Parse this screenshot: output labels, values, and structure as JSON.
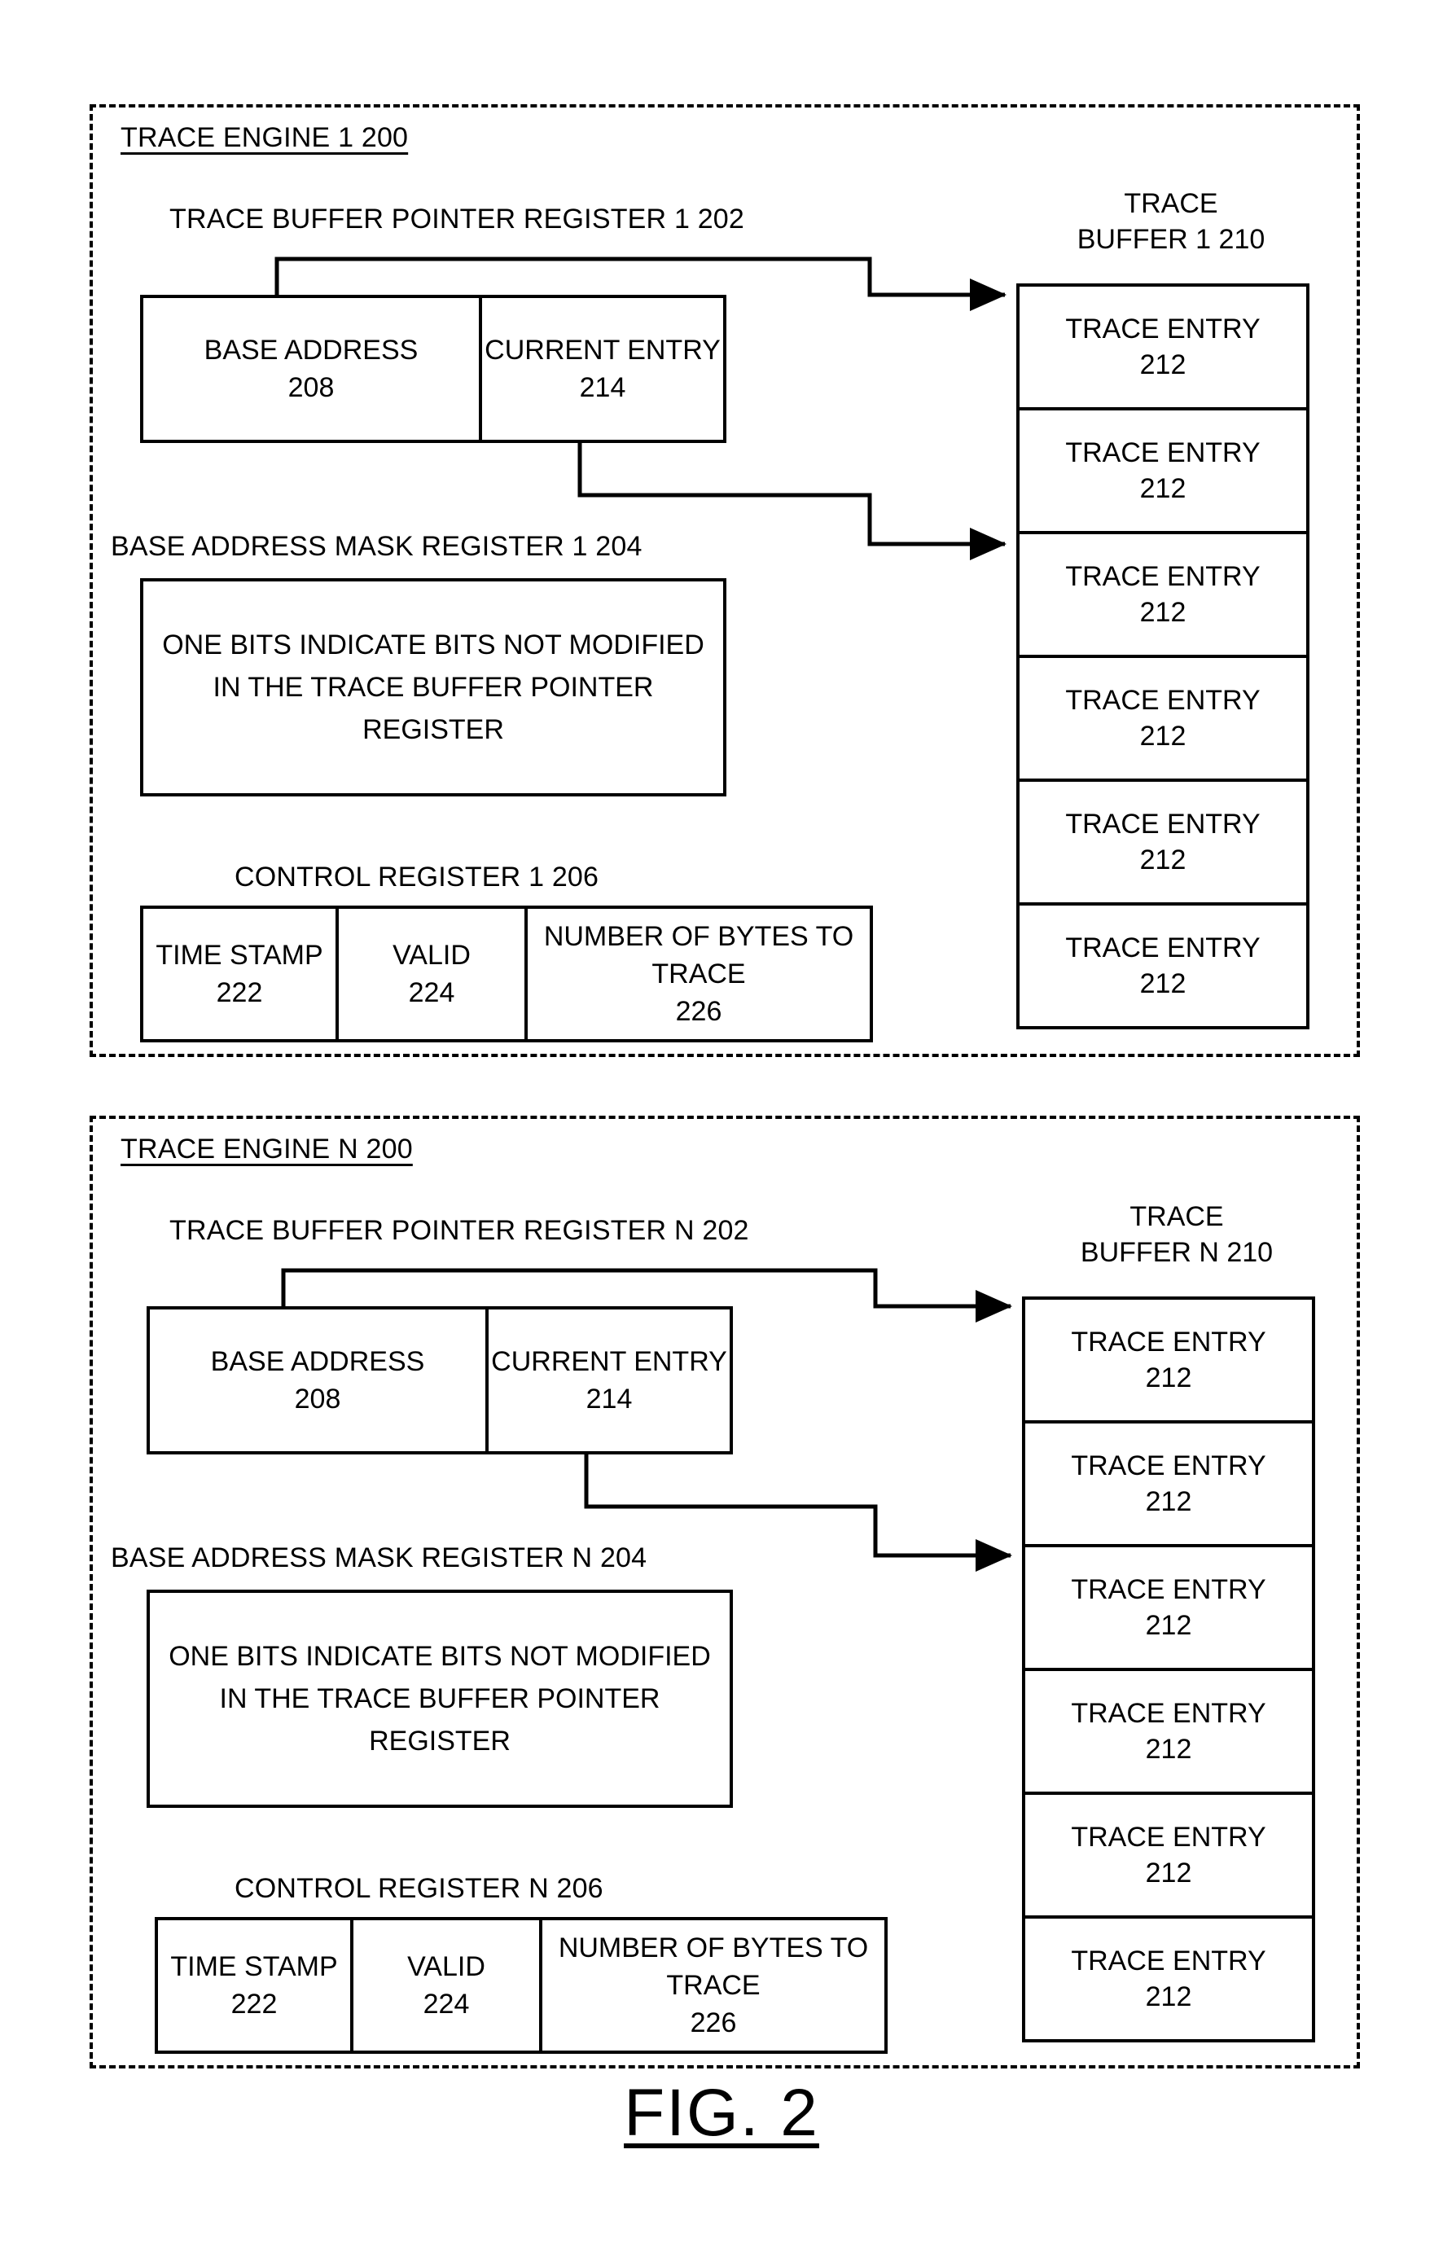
{
  "figure": {
    "caption": "FIG. 2"
  },
  "engines": [
    {
      "title": "TRACE ENGINE 1 200",
      "pointer_register": {
        "caption": "TRACE BUFFER POINTER REGISTER 1 202",
        "fields": [
          {
            "label": "BASE ADDRESS",
            "ref": "208"
          },
          {
            "label": "CURRENT ENTRY",
            "ref": "214"
          }
        ]
      },
      "mask_register": {
        "caption": "BASE ADDRESS MASK REGISTER 1 204",
        "body": "ONE BITS INDICATE BITS NOT MODIFIED IN THE TRACE BUFFER POINTER REGISTER"
      },
      "control_register": {
        "caption": "CONTROL REGISTER 1 206",
        "fields": [
          {
            "label": "TIME STAMP",
            "ref": "222"
          },
          {
            "label": "VALID",
            "ref": "224"
          },
          {
            "label": "NUMBER OF BYTES TO TRACE",
            "ref": "226"
          }
        ]
      },
      "trace_buffer": {
        "caption_line1": "TRACE",
        "caption_line2": "BUFFER 1 210",
        "entries": [
          {
            "label": "TRACE ENTRY",
            "ref": "212"
          },
          {
            "label": "TRACE ENTRY",
            "ref": "212"
          },
          {
            "label": "TRACE ENTRY",
            "ref": "212"
          },
          {
            "label": "TRACE ENTRY",
            "ref": "212"
          },
          {
            "label": "TRACE ENTRY",
            "ref": "212"
          },
          {
            "label": "TRACE ENTRY",
            "ref": "212"
          }
        ]
      }
    },
    {
      "title": "TRACE ENGINE N 200",
      "pointer_register": {
        "caption": "TRACE BUFFER POINTER REGISTER N 202",
        "fields": [
          {
            "label": "BASE ADDRESS",
            "ref": "208"
          },
          {
            "label": "CURRENT ENTRY",
            "ref": "214"
          }
        ]
      },
      "mask_register": {
        "caption": "BASE ADDRESS MASK REGISTER N 204",
        "body": "ONE BITS INDICATE BITS NOT MODIFIED IN THE TRACE BUFFER POINTER REGISTER"
      },
      "control_register": {
        "caption": "CONTROL REGISTER N 206",
        "fields": [
          {
            "label": "TIME STAMP",
            "ref": "222"
          },
          {
            "label": "VALID",
            "ref": "224"
          },
          {
            "label": "NUMBER OF BYTES TO TRACE",
            "ref": "226"
          }
        ]
      },
      "trace_buffer": {
        "caption_line1": "TRACE",
        "caption_line2": "BUFFER N 210",
        "entries": [
          {
            "label": "TRACE ENTRY",
            "ref": "212"
          },
          {
            "label": "TRACE ENTRY",
            "ref": "212"
          },
          {
            "label": "TRACE ENTRY",
            "ref": "212"
          },
          {
            "label": "TRACE ENTRY",
            "ref": "212"
          },
          {
            "label": "TRACE ENTRY",
            "ref": "212"
          },
          {
            "label": "TRACE ENTRY",
            "ref": "212"
          }
        ]
      }
    }
  ],
  "colors": {
    "ink": "#000000",
    "paper": "#ffffff"
  }
}
